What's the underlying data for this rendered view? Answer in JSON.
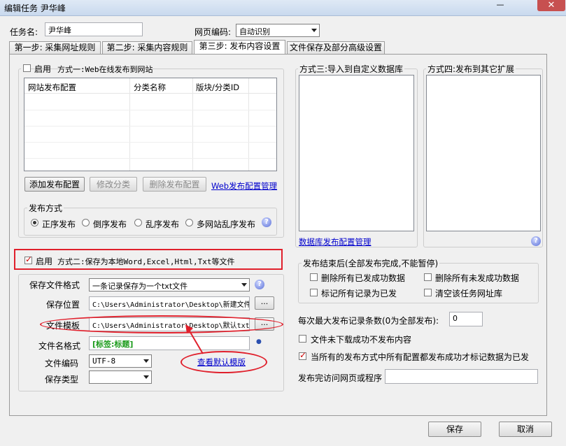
{
  "window": {
    "title": "编辑任务 尹华峰",
    "minimize": "—",
    "close": "✕"
  },
  "task": {
    "name_label": "任务名:",
    "name_value": "尹华峰",
    "encoding_label": "网页编码:",
    "encoding_value": "自动识别"
  },
  "tabs": [
    {
      "label": "第一步: 采集网址规则"
    },
    {
      "label": "第二步: 采集内容规则"
    },
    {
      "label": "第三步: 发布内容设置"
    },
    {
      "label": "文件保存及部分高级设置"
    }
  ],
  "method1": {
    "enable_label": "启用",
    "title": "方式一:Web在线发布到网站",
    "checked": false,
    "columns": [
      "网站发布配置",
      "分类名称",
      "版块/分类ID"
    ],
    "add_button": "添加发布配置",
    "edit_button": "修改分类",
    "delete_button": "删除发布配置",
    "manage_link": "Web发布配置管理"
  },
  "publish_mode": {
    "title": "发布方式",
    "options": [
      "正序发布",
      "倒序发布",
      "乱序发布",
      "多网站乱序发布"
    ],
    "selected": "正序发布"
  },
  "method2": {
    "enable_label": "启用",
    "title": "方式二:保存为本地Word,Excel,Html,Txt等文件",
    "checked": true,
    "format_label": "保存文件格式",
    "format_value": "一条记录保存为一个txt文件",
    "location_label": "保存位置",
    "location_value": "C:\\Users\\Administrator\\Desktop\\新建文件夹",
    "template_label": "文件模板",
    "template_value": "C:\\Users\\Administrator\\Desktop\\默认txt",
    "browse_label": "...",
    "filename_label": "文件名格式",
    "filename_value": "[标签:标题]",
    "file_encoding_label": "文件编码",
    "file_encoding_value": "UTF-8",
    "save_type_label": "保存类型",
    "save_type_value": "",
    "view_template_link": "查看默认模版"
  },
  "method3": {
    "title": "方式三:导入到自定义数据库",
    "manage_link": "数据库发布配置管理"
  },
  "method4": {
    "title": "方式四:发布到其它扩展"
  },
  "after_publish": {
    "title": "发布结束后(全部发布完成,不能暂停)",
    "options": [
      "删除所有已发成功数据",
      "删除所有未发成功数据",
      "标记所有记录为已发",
      "清空该任务网址库"
    ]
  },
  "max_records": {
    "label": "每次最大发布记录条数(0为全部发布):",
    "value": "0"
  },
  "no_download_no_publish": {
    "label": "文件未下载成功不发布内容",
    "checked": false
  },
  "all_success_mark": {
    "label": "当所有的发布方式中所有配置都发布成功才标记数据为已发",
    "checked": true
  },
  "visit_after": {
    "label": "发布完访问网页或程序",
    "value": ""
  },
  "footer": {
    "save": "保存",
    "cancel": "取消"
  },
  "icons": {
    "help": "?",
    "dot": "●"
  },
  "colors": {
    "accent_red": "#e0202c",
    "link": "#0000cc"
  }
}
